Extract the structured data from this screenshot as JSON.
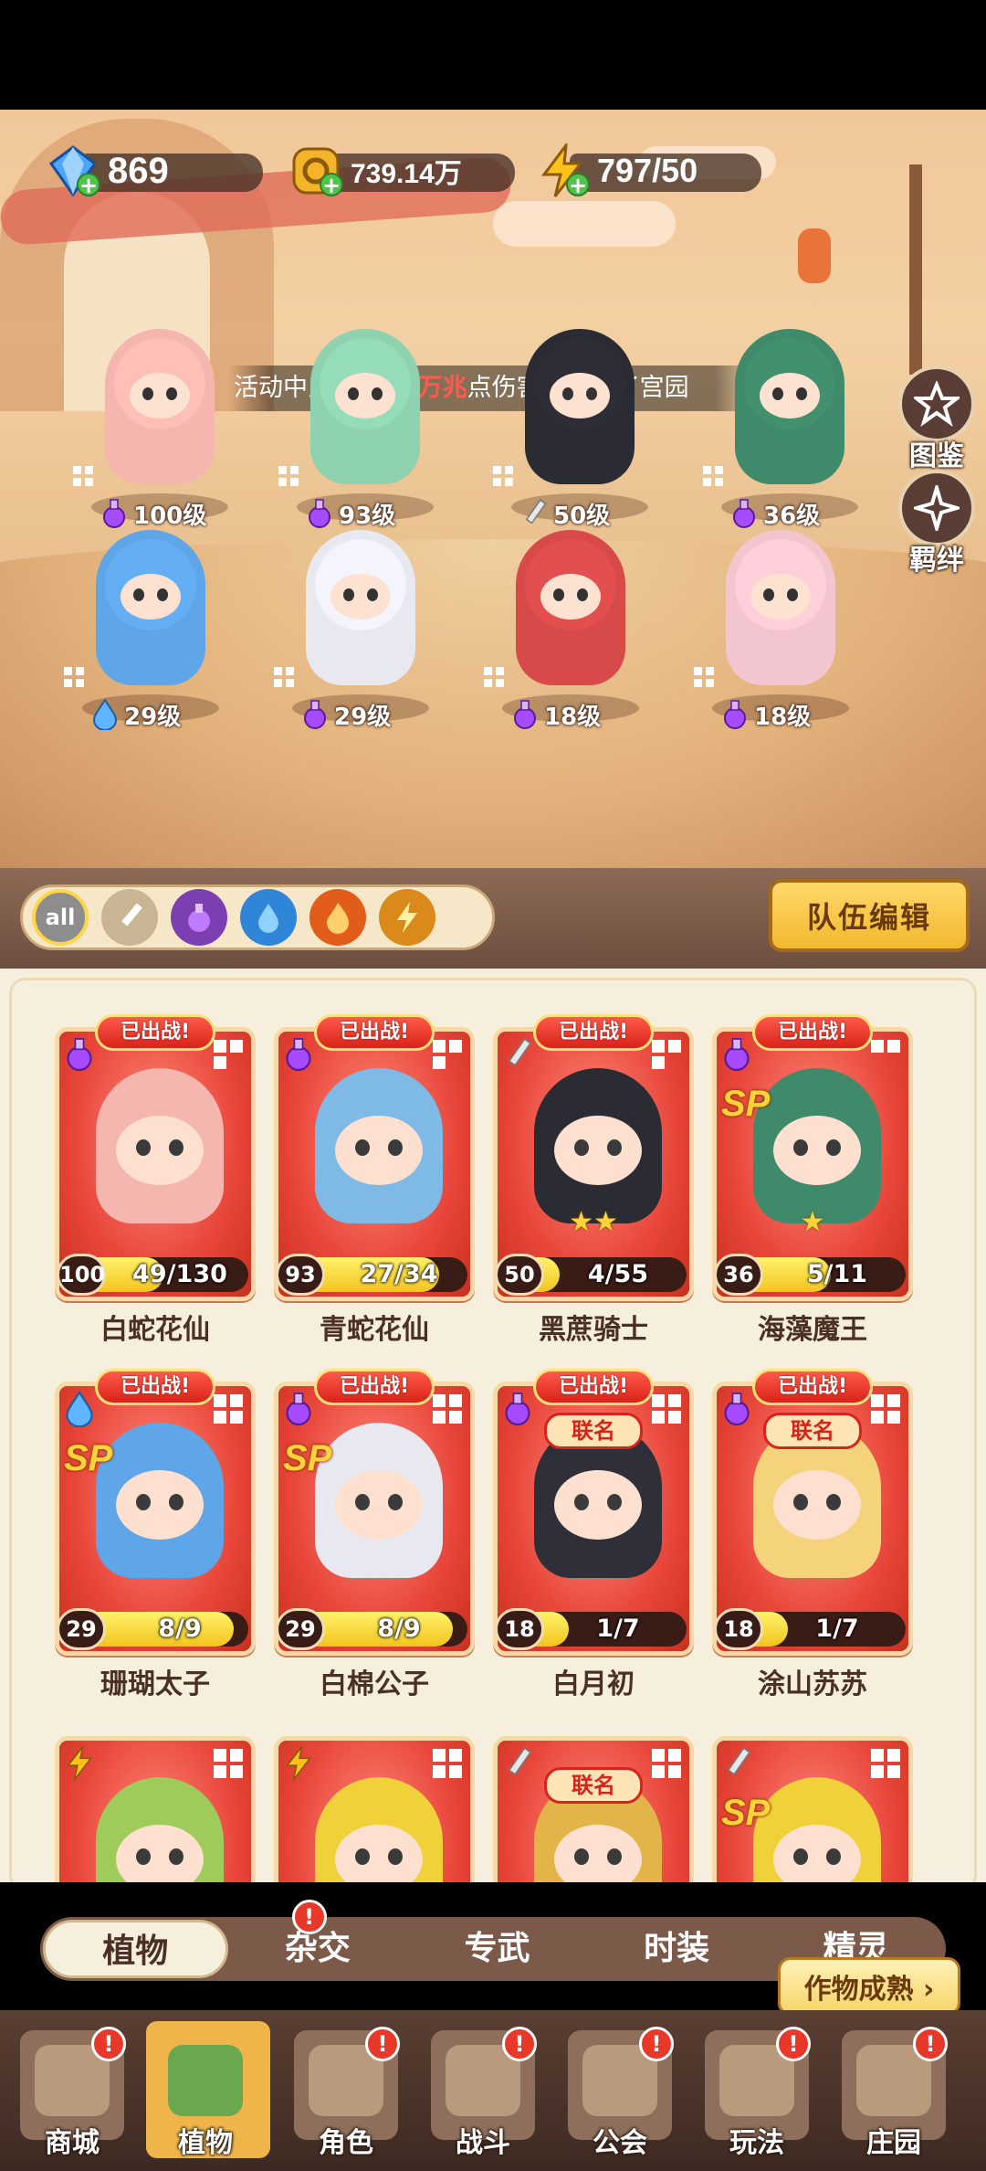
{
  "resources": {
    "diamond": "869",
    "coin": "739.14万",
    "energy": "797/50"
  },
  "marquee": {
    "prefix": "活动中累计",
    "highlight": "3.46万兆",
    "suffix": "点伤害，超过了宫园"
  },
  "side_buttons": {
    "atlas": "图鉴",
    "bond": "羁绊"
  },
  "field_heroes": [
    {
      "level": "100级",
      "gem": "purple",
      "color": "#f6b6b0"
    },
    {
      "level": "93级",
      "gem": "purple",
      "color": "#8ed2b0"
    },
    {
      "level": "50级",
      "gem": "sword",
      "color": "#2b2b33"
    },
    {
      "level": "36级",
      "gem": "purple",
      "color": "#3e8a6a"
    },
    {
      "level": "29级",
      "gem": "water",
      "color": "#5fa6e8"
    },
    {
      "level": "29级",
      "gem": "purple",
      "color": "#e8e8f0"
    },
    {
      "level": "18级",
      "gem": "purple",
      "color": "#d84a4a"
    },
    {
      "level": "18级",
      "gem": "purple",
      "color": "#f3c6cf"
    }
  ],
  "filters": [
    "all",
    "sword",
    "poison",
    "water",
    "fire",
    "thunder"
  ],
  "team_edit_label": "队伍编辑",
  "cards": [
    {
      "name": "白蛇花仙",
      "tag": "已出战!",
      "level": "100",
      "progress": "49/130",
      "fill": 0.38,
      "gem": "purple",
      "grid": "3",
      "color": "#f6b6b0"
    },
    {
      "name": "青蛇花仙",
      "tag": "已出战!",
      "level": "93",
      "progress": "27/34",
      "fill": 0.79,
      "gem": "purple",
      "grid": "3",
      "color": "#7fb9e6"
    },
    {
      "name": "黑蔗骑士",
      "tag": "已出战!",
      "level": "50",
      "progress": "4/55",
      "fill": 0.07,
      "gem": "sword",
      "grid": "3",
      "stars": "★★",
      "color": "#2b2b33"
    },
    {
      "name": "海藻魔王",
      "tag": "已出战!",
      "level": "36",
      "progress": "5/11",
      "fill": 0.45,
      "gem": "purple",
      "grid": "2",
      "sp": "SP",
      "stars": "★",
      "color": "#3e8a6a"
    },
    {
      "name": "珊瑚太子",
      "tag": "已出战!",
      "level": "29",
      "progress": "8/9",
      "fill": 0.89,
      "gem": "water",
      "grid": "4",
      "sp": "SP",
      "color": "#5fa6e8"
    },
    {
      "name": "白棉公子",
      "tag": "已出战!",
      "level": "29",
      "progress": "8/9",
      "fill": 0.89,
      "gem": "purple",
      "grid": "4",
      "sp": "SP",
      "color": "#e8e8f0"
    },
    {
      "name": "白月初",
      "tag": "已出战!",
      "level": "18",
      "progress": "1/7",
      "fill": 0.14,
      "gem": "purple",
      "grid": "4",
      "lm": "联名",
      "color": "#2f2f3a"
    },
    {
      "name": "涂山苏苏",
      "tag": "已出战!",
      "level": "18",
      "progress": "1/7",
      "fill": 0.14,
      "gem": "purple",
      "grid": "4",
      "lm": "联名",
      "color": "#f5d37a"
    },
    {
      "name": "",
      "tag": "",
      "level": "",
      "progress": "",
      "fill": 0,
      "gem": "thunder",
      "grid": "4",
      "color": "#9ecb5a"
    },
    {
      "name": "",
      "tag": "",
      "level": "",
      "progress": "",
      "fill": 0,
      "gem": "thunder",
      "grid": "4",
      "color": "#f1d13a"
    },
    {
      "name": "",
      "tag": "",
      "level": "",
      "progress": "",
      "fill": 0,
      "gem": "sword",
      "grid": "4",
      "lm": "联名",
      "color": "#e2b44a"
    },
    {
      "name": "",
      "tag": "",
      "level": "",
      "progress": "",
      "fill": 0,
      "gem": "sword",
      "grid": "4",
      "sp": "SP",
      "color": "#f1d13a"
    }
  ],
  "tabs": [
    {
      "label": "植物",
      "active": true
    },
    {
      "label": "杂交",
      "badge": true
    },
    {
      "label": "专武"
    },
    {
      "label": "时装"
    },
    {
      "label": "精灵"
    }
  ],
  "harvest_label": "作物成熟 ›",
  "nav": [
    {
      "label": "商城",
      "badge": true
    },
    {
      "label": "植物",
      "active": true
    },
    {
      "label": "角色",
      "badge": true
    },
    {
      "label": "战斗",
      "badge": true
    },
    {
      "label": "公会",
      "badge": true
    },
    {
      "label": "玩法",
      "badge": true
    },
    {
      "label": "庄园",
      "badge": true
    }
  ],
  "colors": {
    "card_red": "#e8463a",
    "gold": "#f3b82f",
    "brown": "#5a3f33"
  }
}
